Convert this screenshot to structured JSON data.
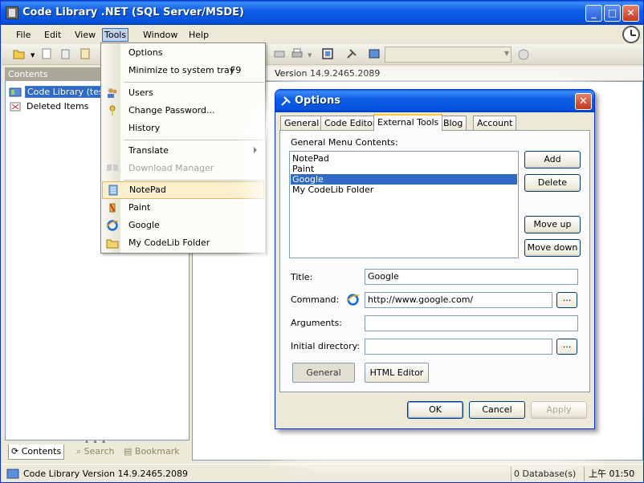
{
  "window": {
    "title": "Code Library .NET (SQL Server/MSDE)",
    "buttons": {
      "minimize": "_",
      "maximize": "□",
      "close": "✕"
    }
  },
  "menubar": [
    "File",
    "Edit",
    "View",
    "Tools",
    "Window",
    "Help"
  ],
  "toolbar": {
    "combo_value": ""
  },
  "left_pane": {
    "header": "Contents",
    "tree": [
      "Code Library (test)",
      "Deleted Items"
    ],
    "tabs": [
      "Contents",
      "Search",
      "Bookmark"
    ]
  },
  "version_strip": "Version 14.9.2465.2089",
  "statusbar": {
    "message": "Code Library Version 14.9.2465.2089",
    "database_count": "0 Database(s)",
    "time": "上午 01:50"
  },
  "tools_menu": {
    "items": [
      {
        "label": "Options",
        "shortcut": ""
      },
      {
        "label": "Minimize to system tray",
        "shortcut": "F9"
      },
      {
        "label": "Users",
        "shortcut": ""
      },
      {
        "label": "Change Password...",
        "shortcut": ""
      },
      {
        "label": "History",
        "shortcut": ""
      },
      {
        "label": "Translate",
        "shortcut": ""
      },
      {
        "label": "Download Manager",
        "shortcut": ""
      },
      {
        "label": "NotePad",
        "shortcut": ""
      },
      {
        "label": "Paint",
        "shortcut": ""
      },
      {
        "label": "Google",
        "shortcut": ""
      },
      {
        "label": "My CodeLib Folder",
        "shortcut": ""
      }
    ]
  },
  "dialog": {
    "title": "Options",
    "tabs": [
      "General",
      "Code Editor",
      "External Tools",
      "Blog",
      "Account"
    ],
    "active_tab": "External Tools",
    "list_label": "General Menu Contents:",
    "list_items": [
      "NotePad",
      "Paint",
      "Google",
      "My CodeLib Folder"
    ],
    "selected_item": "Google",
    "side_buttons": {
      "add": "Add",
      "delete": "Delete",
      "move_up": "Move up",
      "move_down": "Move down"
    },
    "fields": {
      "title_label": "Title:",
      "title_value": "Google",
      "command_label": "Command:",
      "command_value": "http://www.google.com/",
      "arguments_label": "Arguments:",
      "arguments_value": "",
      "initial_dir_label": "Initial directory:",
      "initial_dir_value": "",
      "browse": "..."
    },
    "inner_buttons": {
      "general": "General",
      "html_editor": "HTML Editor"
    },
    "footer_buttons": {
      "ok": "OK",
      "cancel": "Cancel",
      "apply": "Apply"
    }
  },
  "colors": {
    "titlebar_blue": "#0553dd",
    "selection_blue": "#316ac5",
    "menu_hover": "#fcefcd",
    "tab_highlight": "#ffc83c"
  }
}
